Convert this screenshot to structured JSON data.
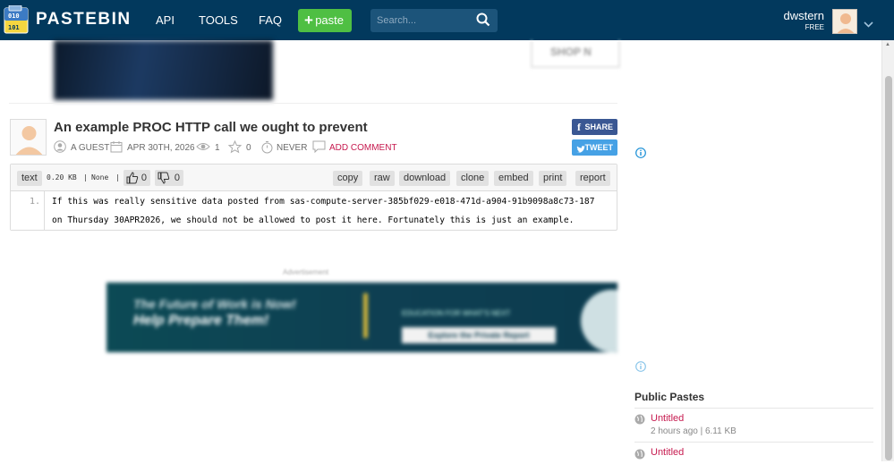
{
  "header": {
    "brand": "PASTEBIN",
    "nav": [
      "API",
      "TOOLS",
      "FAQ"
    ],
    "paste_button": "paste",
    "search_placeholder": "Search...",
    "username": "dwstern",
    "plan": "FREE"
  },
  "top_ad": {
    "text": "SHOP N"
  },
  "paste": {
    "title": "An example PROC HTTP call we ought to prevent",
    "author": "A GUEST",
    "date": "APR 30TH, 2026",
    "views": "1",
    "rating": "0",
    "expires": "NEVER",
    "add_comment": "ADD COMMENT",
    "share_label": "SHARE",
    "tweet_label": "TWEET",
    "syntax": "text",
    "size": "0.20 KB",
    "separator1": "|",
    "category": "None",
    "separator2": "|",
    "likes": "0",
    "dislikes": "0",
    "actions": [
      "copy",
      "raw",
      "download",
      "clone",
      "embed",
      "print",
      "report"
    ],
    "line_number": "1.",
    "code_lines": [
      "If this was really sensitive data posted from sas-compute-server-385bf029-e018-471d-a904-91b9098a8c73-187",
      "on Thursday 30APR2026, we should not be allowed to post it here. Fortunately this is just an example."
    ]
  },
  "bottom_ad": {
    "label": "Advertisement",
    "line1": "The Future of Work is Now!",
    "line2": "Help Prepare Them!",
    "line3": "EDUCATION FOR WHAT'S NEXT",
    "button": "Explore the Private Report"
  },
  "sidebar": {
    "public_pastes_title": "Public Pastes",
    "pastes": [
      {
        "name": "Untitled",
        "meta": "2 hours ago | 6.11 KB"
      },
      {
        "name": "Untitled",
        "meta": ""
      }
    ]
  },
  "colors": {
    "header_bg": "#02395d",
    "paste_button": "#4fbf43",
    "link_red": "#c6194e",
    "facebook": "#3a5793",
    "twitter": "#46a1e5"
  }
}
